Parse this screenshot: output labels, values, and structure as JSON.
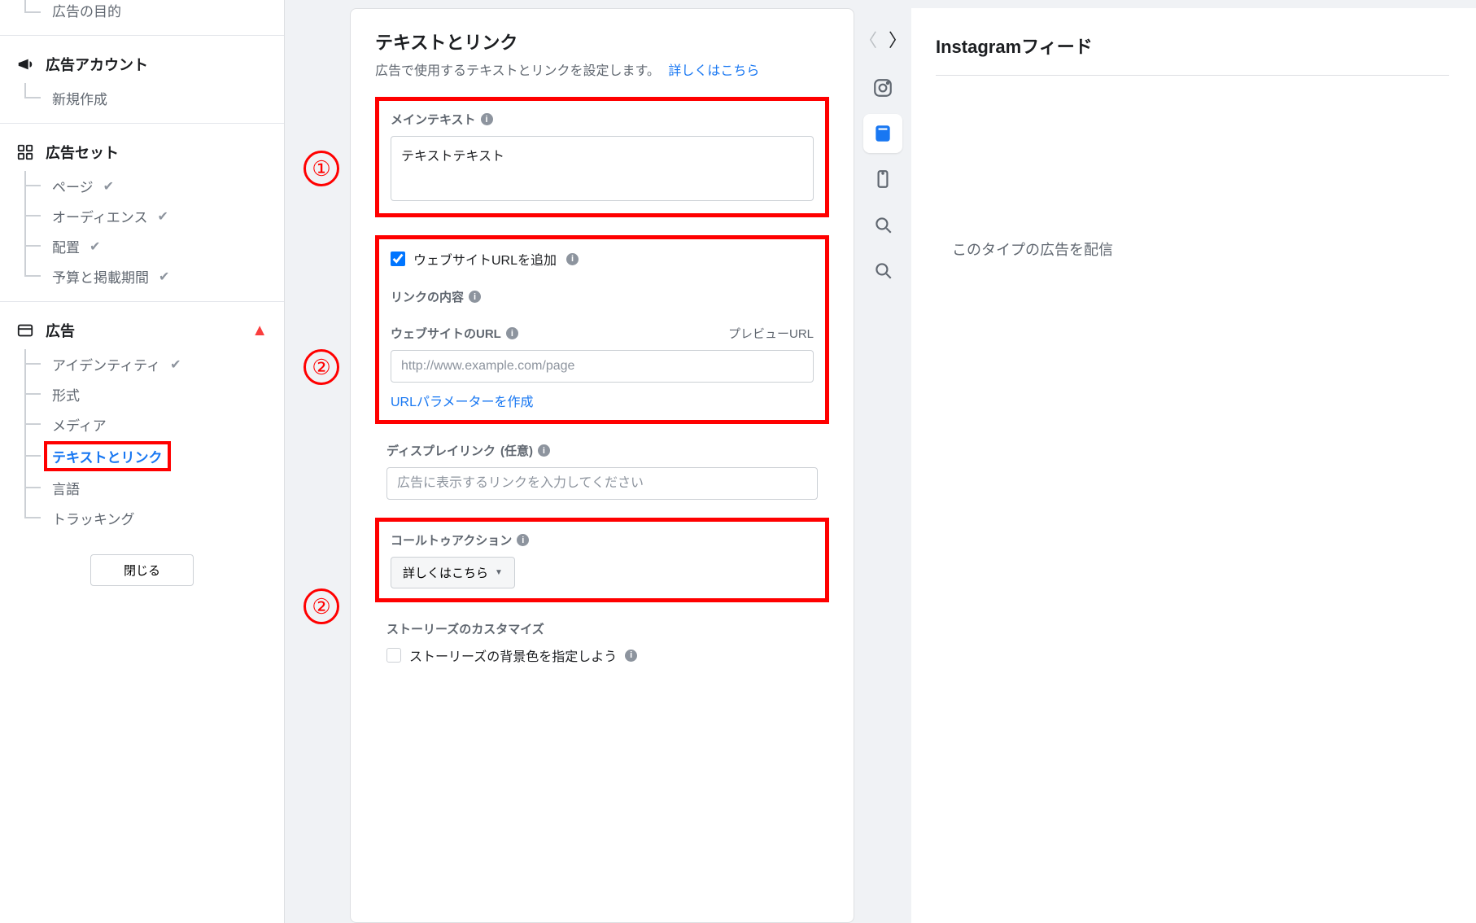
{
  "sidebar": {
    "section_top": {
      "title": "広告の目的"
    },
    "section_account": {
      "title": "広告アカウント",
      "items": [
        {
          "label": "新規作成"
        }
      ]
    },
    "section_adset": {
      "title": "広告セット",
      "items": [
        {
          "label": "ページ",
          "checked": true
        },
        {
          "label": "オーディエンス",
          "checked": true
        },
        {
          "label": "配置",
          "checked": true
        },
        {
          "label": "予算と掲載期間",
          "checked": true
        }
      ]
    },
    "section_ad": {
      "title": "広告",
      "warn": true,
      "items": [
        {
          "label": "アイデンティティ",
          "checked": true
        },
        {
          "label": "形式"
        },
        {
          "label": "メディア"
        },
        {
          "label": "テキストとリンク",
          "active": true
        },
        {
          "label": "言語"
        },
        {
          "label": "トラッキング"
        }
      ]
    },
    "close_label": "閉じる"
  },
  "annotations": {
    "a1": "①",
    "a2": "②",
    "a3": "②"
  },
  "form": {
    "title": "テキストとリンク",
    "subtitle": "広告で使用するテキストとリンクを設定します。",
    "learn_more": "詳しくはこちら",
    "main_text_label": "メインテキスト",
    "main_text_value": "テキストテキスト",
    "add_url_checkbox": "ウェブサイトURLを追加",
    "link_content_label": "リンクの内容",
    "website_url_label": "ウェブサイトのURL",
    "preview_url_label": "プレビューURL",
    "website_url_placeholder": "http://www.example.com/page",
    "create_url_params": "URLパラメーターを作成",
    "display_link_label": "ディスプレイリンク",
    "display_link_optional": "(任意)",
    "display_link_placeholder": "広告に表示するリンクを入力してください",
    "cta_label": "コールトゥアクション",
    "cta_value": "詳しくはこちら",
    "stories_customize_label": "ストーリーズのカスタマイズ",
    "stories_bg_label": "ストーリーズの背景色を指定しよう"
  },
  "preview": {
    "title": "Instagramフィード",
    "message": "このタイプの広告を配信"
  }
}
